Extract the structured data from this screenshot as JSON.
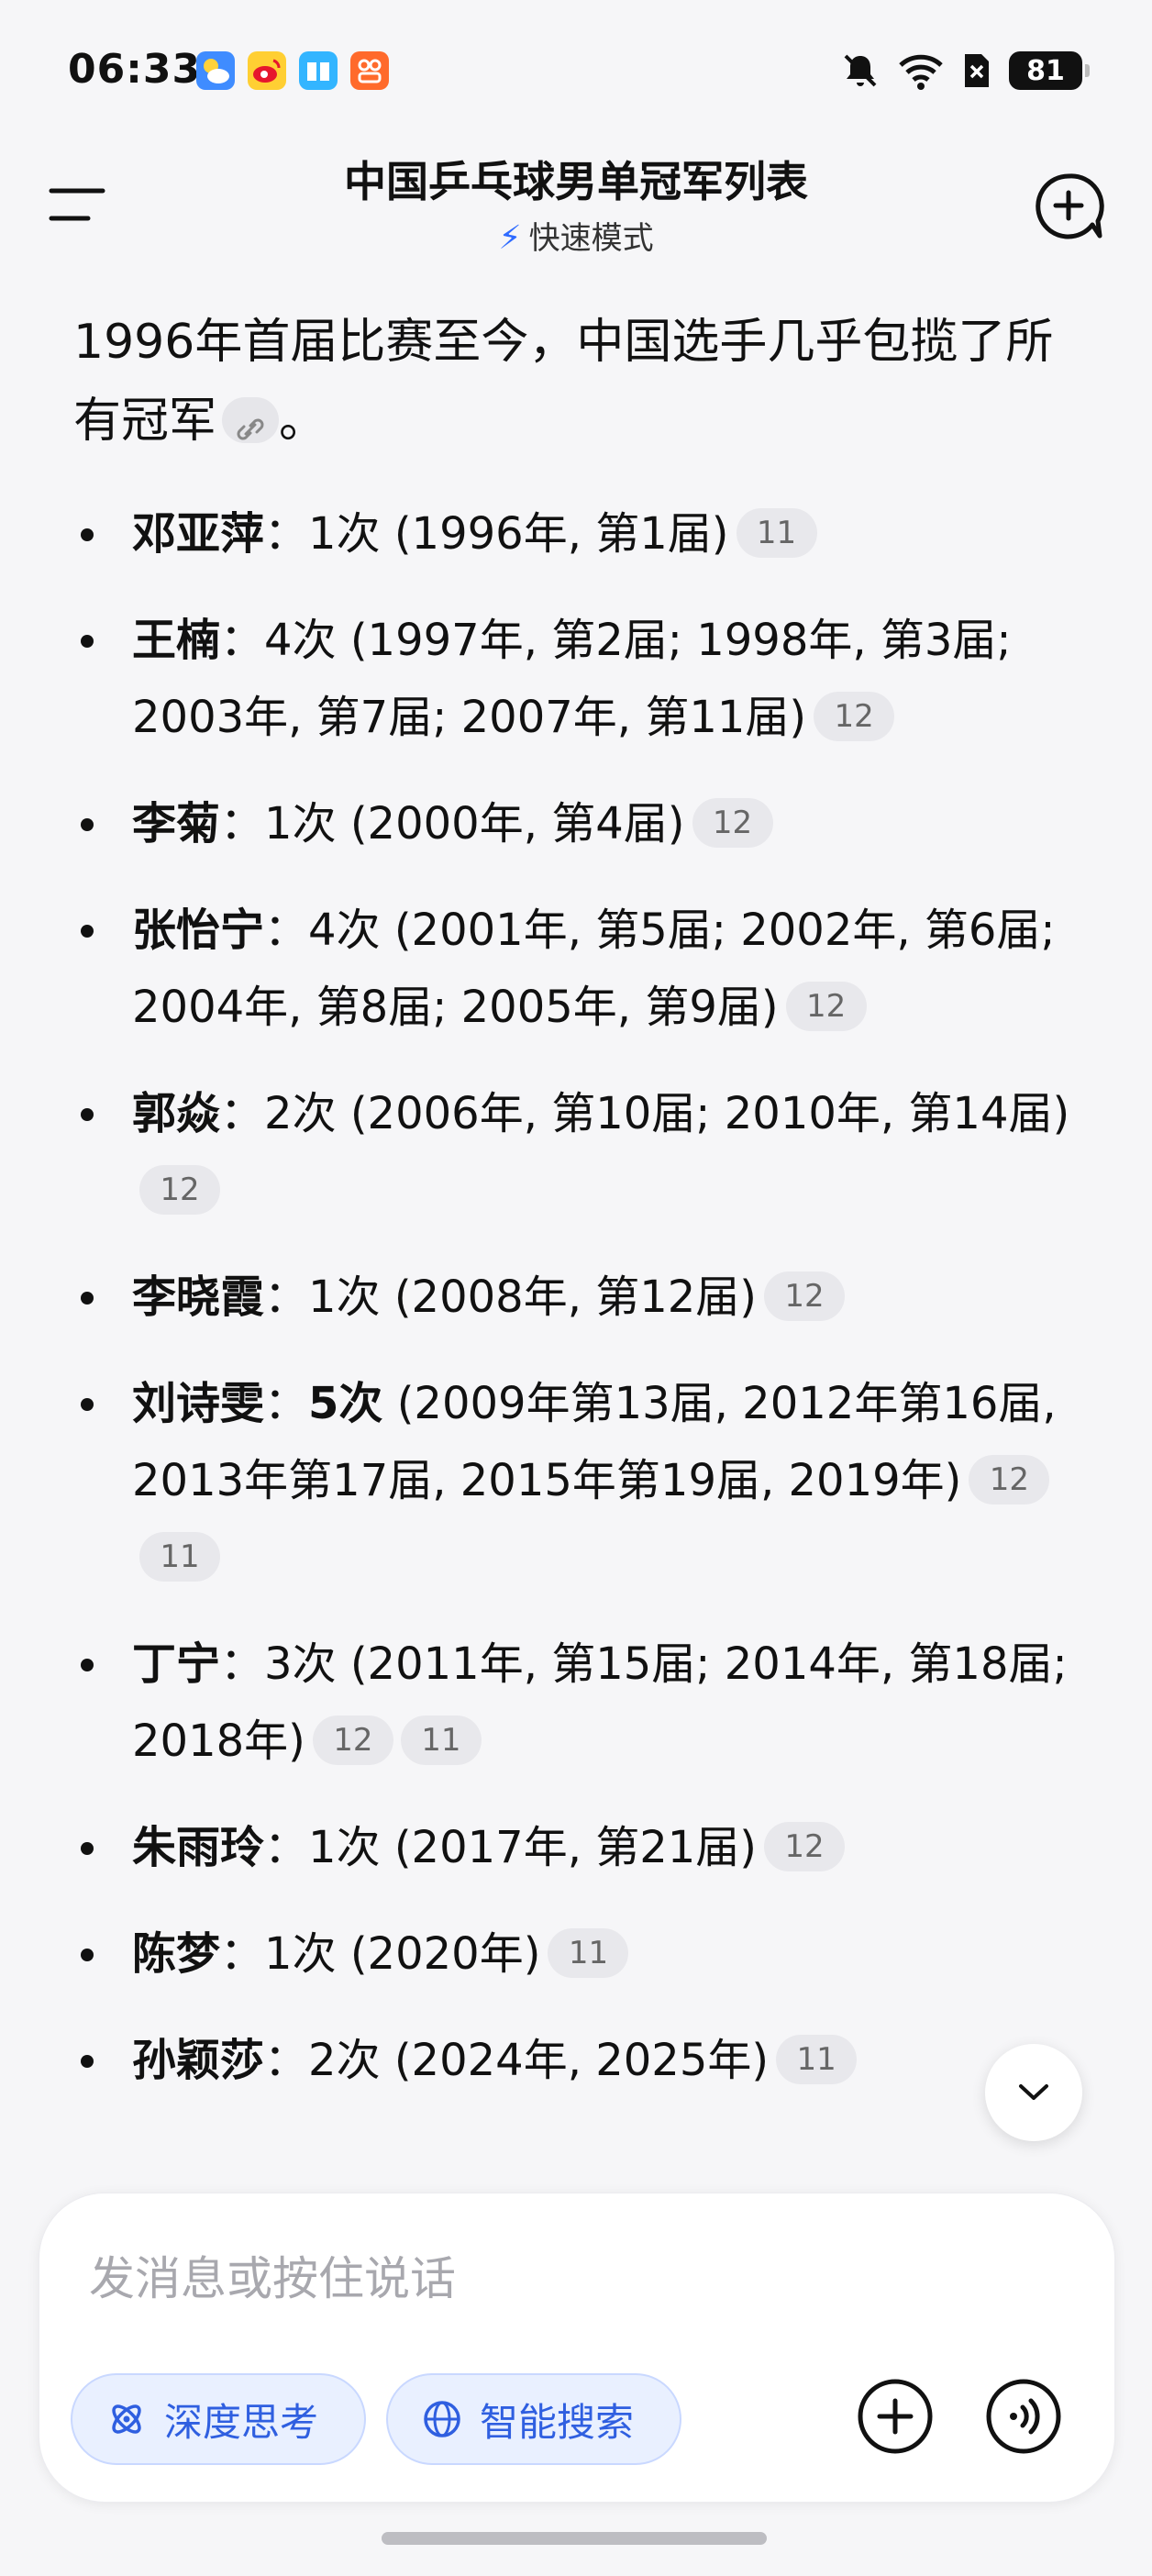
{
  "status_bar": {
    "time": "06:33",
    "battery": "81"
  },
  "header": {
    "title": "中国乒乓球男单冠军列表",
    "mode": "快速模式"
  },
  "content": {
    "intro": "1996年首届比赛至今，中国选手几乎包揽了所有冠军",
    "intro_end": "。",
    "champions": [
      {
        "name": "邓亚萍",
        "sep": "：",
        "detail": "1次 (1996年, 第1届)",
        "cites": [
          "11"
        ]
      },
      {
        "name": "王楠",
        "sep": "：",
        "detail": "4次 (1997年, 第2届; 1998年, 第3届; 2003年, 第7届; 2007年, 第11届)",
        "cites": [
          "12"
        ]
      },
      {
        "name": "李菊",
        "sep": "：",
        "detail": "1次 (2000年, 第4届)",
        "cites": [
          "12"
        ]
      },
      {
        "name": "张怡宁",
        "sep": "：",
        "detail": "4次 (2001年, 第5届; 2002年, 第6届; 2004年, 第8届; 2005年, 第9届)",
        "cites": [
          "12"
        ]
      },
      {
        "name": "郭焱",
        "sep": "：",
        "detail": "2次 (2006年, 第10届; 2010年, 第14届)",
        "cites": [
          "12"
        ]
      },
      {
        "name": "李晓霞",
        "sep": "：",
        "detail": "1次 (2008年, 第12届)",
        "cites": [
          "12"
        ]
      },
      {
        "name": "刘诗雯",
        "sep": "：",
        "count_bold": "5次",
        "detail": " (2009年第13届, 2012年第16届, 2013年第17届, 2015年第19届, 2019年)",
        "cites": [
          "12",
          "11"
        ]
      },
      {
        "name": "丁宁",
        "sep": "：",
        "detail": "3次 (2011年, 第15届; 2014年, 第18届; 2018年)",
        "cites": [
          "12",
          "11"
        ]
      },
      {
        "name": "朱雨玲",
        "sep": "：",
        "detail": "1次 (2017年, 第21届)",
        "cites": [
          "12"
        ]
      },
      {
        "name": "陈梦",
        "sep": "：",
        "detail": "1次 (2020年)",
        "cites": [
          "11"
        ]
      },
      {
        "name": "孙颖莎",
        "sep": "：",
        "detail": "2次 (2024年, 2025年)",
        "cites": [
          "11"
        ]
      }
    ]
  },
  "composer": {
    "placeholder": "发消息或按住说话",
    "deep_think": "深度思考",
    "smart_search": "智能搜索"
  },
  "colors": {
    "accent": "#2f6bff",
    "chip_bg": "#e9f0ff",
    "cite_bg": "#e8e8ec"
  }
}
